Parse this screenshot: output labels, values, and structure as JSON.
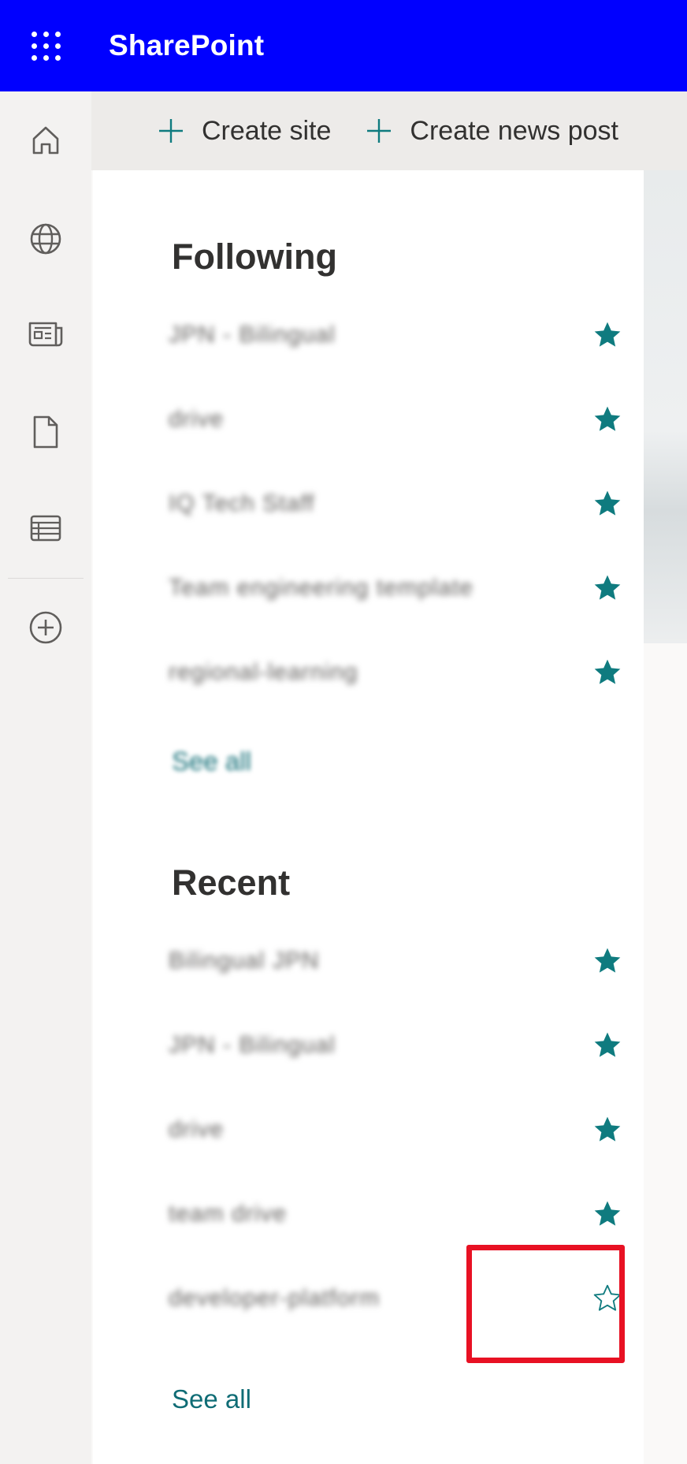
{
  "app": {
    "title": "SharePoint",
    "suitebar_color": "#0000ff",
    "accent_color": "#0f7b7f"
  },
  "rail": {
    "items": [
      {
        "name": "home-icon"
      },
      {
        "name": "globe-icon"
      },
      {
        "name": "news-icon"
      },
      {
        "name": "document-icon"
      },
      {
        "name": "list-icon"
      },
      {
        "name": "create-circle-icon"
      }
    ]
  },
  "commands": {
    "create_site": "Create site",
    "create_news_post": "Create news post"
  },
  "following": {
    "title": "Following",
    "items": [
      {
        "label": "JPN - Bilingual",
        "starred": true
      },
      {
        "label": "drive",
        "starred": true
      },
      {
        "label": "IQ Tech Staff",
        "starred": true
      },
      {
        "label": "Team engineering template",
        "starred": true
      },
      {
        "label": "regional-learning",
        "starred": true
      }
    ],
    "see_all": "See all"
  },
  "recent": {
    "title": "Recent",
    "items": [
      {
        "label": "Bilingual JPN",
        "starred": true
      },
      {
        "label": "JPN - Bilingual",
        "starred": true
      },
      {
        "label": "drive",
        "starred": true
      },
      {
        "label": "team drive",
        "starred": true
      },
      {
        "label": "developer-platform",
        "starred": false
      }
    ],
    "see_all": "See all"
  }
}
